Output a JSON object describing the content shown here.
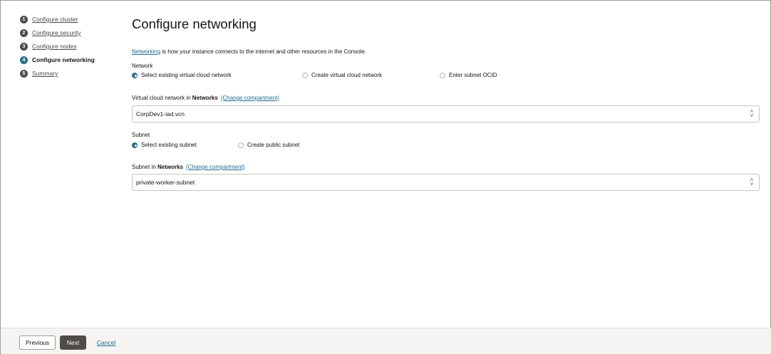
{
  "steps": [
    {
      "number": "1",
      "label": "Configure cluster"
    },
    {
      "number": "2",
      "label": "Configure security"
    },
    {
      "number": "3",
      "label": "Configure nodes"
    },
    {
      "number": "4",
      "label": "Configure networking"
    },
    {
      "number": "5",
      "label": "Summary"
    }
  ],
  "main": {
    "title": "Configure networking",
    "intro_link": "Networking",
    "intro_text": " is how your instance connects to the internet and other resources in the Console.",
    "network": {
      "label": "Network",
      "options": [
        "Select existing virtual cloud network",
        "Create virtual cloud network",
        "Enter subnet OCID"
      ],
      "selected_index": 0
    },
    "vcn_field": {
      "label_prefix": "Virtual cloud network in ",
      "compartment": "Networks",
      "change_link": "(Change compartment)",
      "value": "CorpDev1-iad.vcn"
    },
    "subnet": {
      "label": "Subnet",
      "options": [
        "Select existing subnet",
        "Create public subnet"
      ],
      "selected_index": 0
    },
    "subnet_field": {
      "label_prefix": "Subnet in ",
      "compartment": "Networks",
      "change_link": "(Change compartment)",
      "value": "private-worker-subnet"
    }
  },
  "footer": {
    "previous": "Previous",
    "next": "Next",
    "cancel": "Cancel"
  },
  "colors": {
    "accent": "#2c6e8c",
    "link": "#1f6b8e",
    "primary_button": "#4f4b47",
    "footer_bg": "#f5f4f2"
  }
}
